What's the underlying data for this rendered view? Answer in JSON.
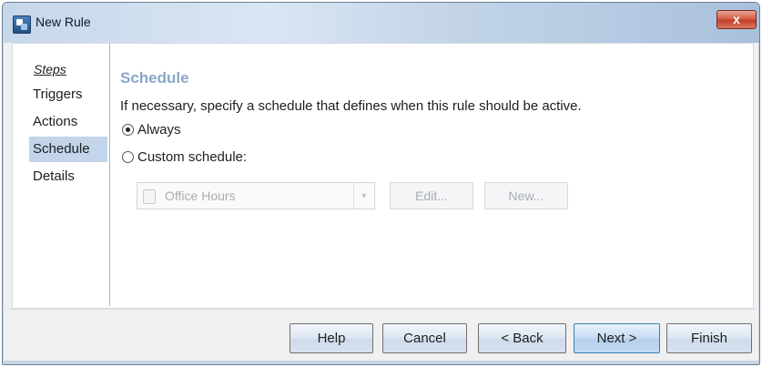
{
  "window": {
    "title": "New Rule",
    "close_label": "x"
  },
  "sidebar": {
    "steps_label": "Steps",
    "items": [
      {
        "label": "Triggers",
        "active": false
      },
      {
        "label": "Actions",
        "active": false
      },
      {
        "label": "Schedule",
        "active": true
      },
      {
        "label": "Details",
        "active": false
      }
    ]
  },
  "main": {
    "section_title": "Schedule",
    "description": "If necessary, specify a schedule that defines when this rule should be active.",
    "options": [
      {
        "label": "Always",
        "checked": true
      },
      {
        "label": "Custom schedule:",
        "checked": false
      }
    ],
    "schedule_select": {
      "value": "Office Hours",
      "enabled": false
    },
    "edit_label": "Edit...",
    "new_label": "New..."
  },
  "footer": {
    "help_label": "Help",
    "cancel_label": "Cancel",
    "back_label": "< Back",
    "next_label": "Next >",
    "finish_label": "Finish"
  },
  "colors": {
    "accent": "#8aa6c8",
    "selected_step": "#c2d5ea",
    "close_button": "#c23d26"
  }
}
